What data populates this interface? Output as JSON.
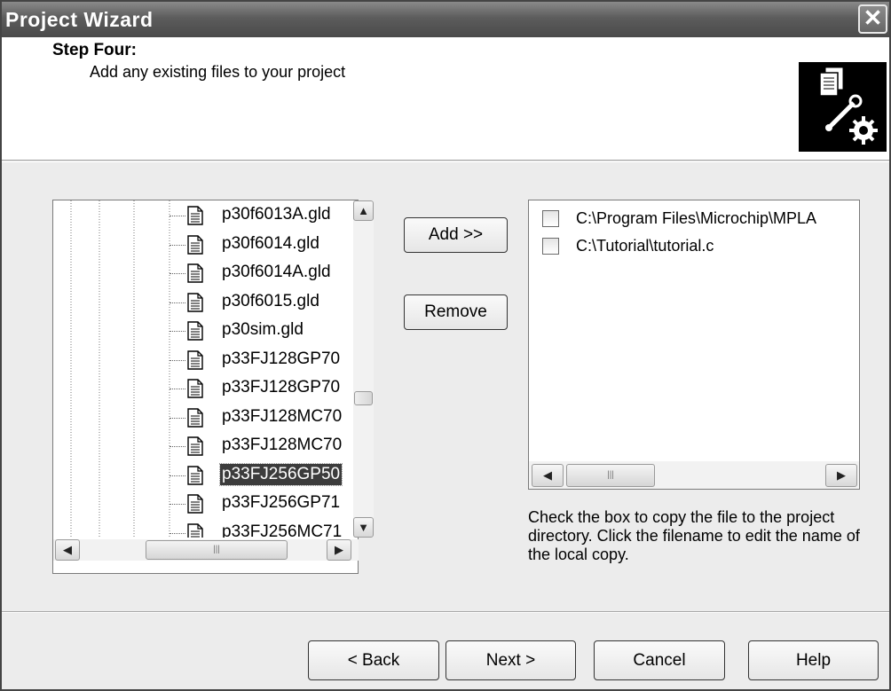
{
  "window": {
    "title": "Project Wizard",
    "close_icon": "close-icon"
  },
  "header": {
    "step_title": "Step Four:",
    "step_description": "Add any existing files to your project",
    "icon": "files-wrench-gear-icon"
  },
  "tree": {
    "items": [
      {
        "name": "p30f6013A.gld",
        "selected": false
      },
      {
        "name": "p30f6014.gld",
        "selected": false
      },
      {
        "name": "p30f6014A.gld",
        "selected": false
      },
      {
        "name": "p30f6015.gld",
        "selected": false
      },
      {
        "name": "p30sim.gld",
        "selected": false
      },
      {
        "name": "p33FJ128GP70",
        "selected": false
      },
      {
        "name": "p33FJ128GP70",
        "selected": false
      },
      {
        "name": "p33FJ128MC70",
        "selected": false
      },
      {
        "name": "p33FJ128MC70",
        "selected": false
      },
      {
        "name": "p33FJ256GP50",
        "selected": true
      },
      {
        "name": "p33FJ256GP71",
        "selected": false
      },
      {
        "name": "p33FJ256MC71",
        "selected": false
      }
    ]
  },
  "actions": {
    "add_label": "Add >>",
    "remove_label": "Remove"
  },
  "project_files": {
    "items": [
      {
        "path": "C:\\Program Files\\Microchip\\MPLA",
        "checked": false
      },
      {
        "path": "C:\\Tutorial\\tutorial.c",
        "checked": false
      }
    ],
    "help_text": "Check the box to copy the file to the project directory.  Click the filename to edit the name of the local copy."
  },
  "footer": {
    "back_label": "< Back",
    "next_label": "Next >",
    "cancel_label": "Cancel",
    "help_label": "Help"
  },
  "colors": {
    "titlebar": "#5c5c5c",
    "selection": "#3c3c3c",
    "dialog_bg": "#ececec"
  }
}
